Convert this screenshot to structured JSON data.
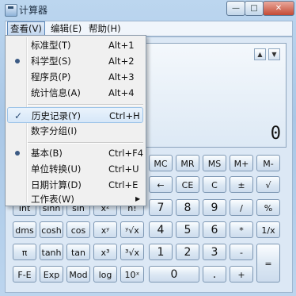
{
  "window": {
    "title": "计算器",
    "controls": {
      "minimize": "—",
      "maximize": "□",
      "close": "✕"
    }
  },
  "menubar": {
    "view": "查看(V)",
    "edit": "编辑(E)",
    "help": "帮助(H)"
  },
  "view_menu": {
    "items": [
      {
        "label": "标准型(T)",
        "shortcut": "Alt+1"
      },
      {
        "label": "科学型(S)",
        "shortcut": "Alt+2"
      },
      {
        "label": "程序员(P)",
        "shortcut": "Alt+3"
      },
      {
        "label": "统计信息(A)",
        "shortcut": "Alt+4"
      },
      {
        "label": "历史记录(Y)",
        "shortcut": "Ctrl+H"
      },
      {
        "label": "数字分组(I)",
        "shortcut": ""
      },
      {
        "label": "基本(B)",
        "shortcut": "Ctrl+F4"
      },
      {
        "label": "单位转换(U)",
        "shortcut": "Ctrl+U"
      },
      {
        "label": "日期计算(D)",
        "shortcut": "Ctrl+E"
      },
      {
        "label": "工作表(W)",
        "shortcut": ""
      }
    ],
    "selected_mode": "科学型(S)",
    "checked": "历史记录(Y)",
    "selected_option": "基本(B)"
  },
  "display": {
    "value": "0",
    "scroll_up": "▲",
    "scroll_down": "▼"
  },
  "buttons": {
    "row1": [
      "MC",
      "MR",
      "MS",
      "M+",
      "M-"
    ],
    "row2": [
      "←",
      "CE",
      "C",
      "±",
      "√"
    ],
    "row3": [
      "Int",
      "sinh",
      "sin",
      "x²",
      "n!",
      "7",
      "8",
      "9",
      "/",
      "%"
    ],
    "row4": [
      "dms",
      "cosh",
      "cos",
      "xʸ",
      "ʸ√x",
      "4",
      "5",
      "6",
      "*",
      "1/x"
    ],
    "row5": [
      "π",
      "tanh",
      "tan",
      "x³",
      "³√x",
      "1",
      "2",
      "3",
      "-",
      "="
    ],
    "row6": [
      "F-E",
      "Exp",
      "Mod",
      "log",
      "10ˣ",
      "0",
      ".",
      "+"
    ]
  }
}
